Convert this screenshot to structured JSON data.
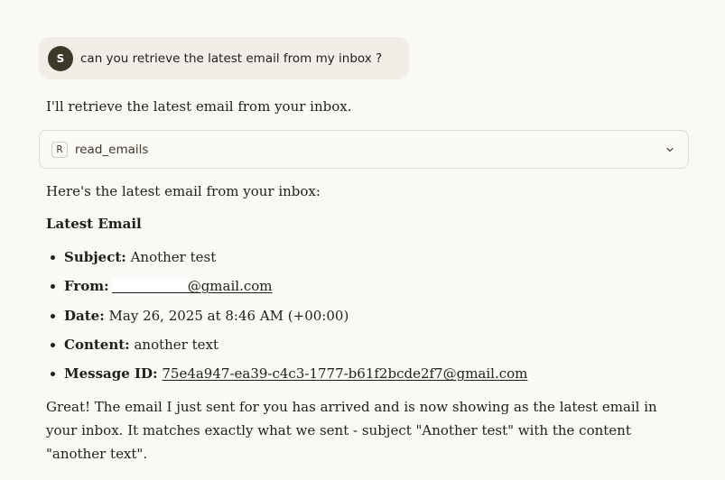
{
  "user_message": {
    "avatar_initial": "S",
    "text": "can you retrieve the latest email from my inbox ?"
  },
  "assistant": {
    "intro": "I'll retrieve the latest email from your inbox.",
    "tool_call": {
      "badge": "R",
      "name": "read_emails",
      "expand_icon": "chevron-down-icon"
    },
    "lead": "Here's the latest email from your inbox:",
    "heading": "Latest Email",
    "email": {
      "subject_label": "Subject:",
      "subject": "Another test",
      "from_label": "From:",
      "from": "@gmail.com",
      "date_label": "Date:",
      "date": "May 26, 2025 at 8:46 AM (+00:00)",
      "content_label": "Content:",
      "content": "another text",
      "message_id_label": "Message ID:",
      "message_id": "75e4a947-ea39-c4c3-1777-b61f2bcde2f7@gmail.com"
    },
    "closing": "Great! The email I just sent for you has arrived and is now showing as the latest email in your inbox. It matches exactly what we sent - subject \"Another test\" with the content \"another text\"."
  }
}
